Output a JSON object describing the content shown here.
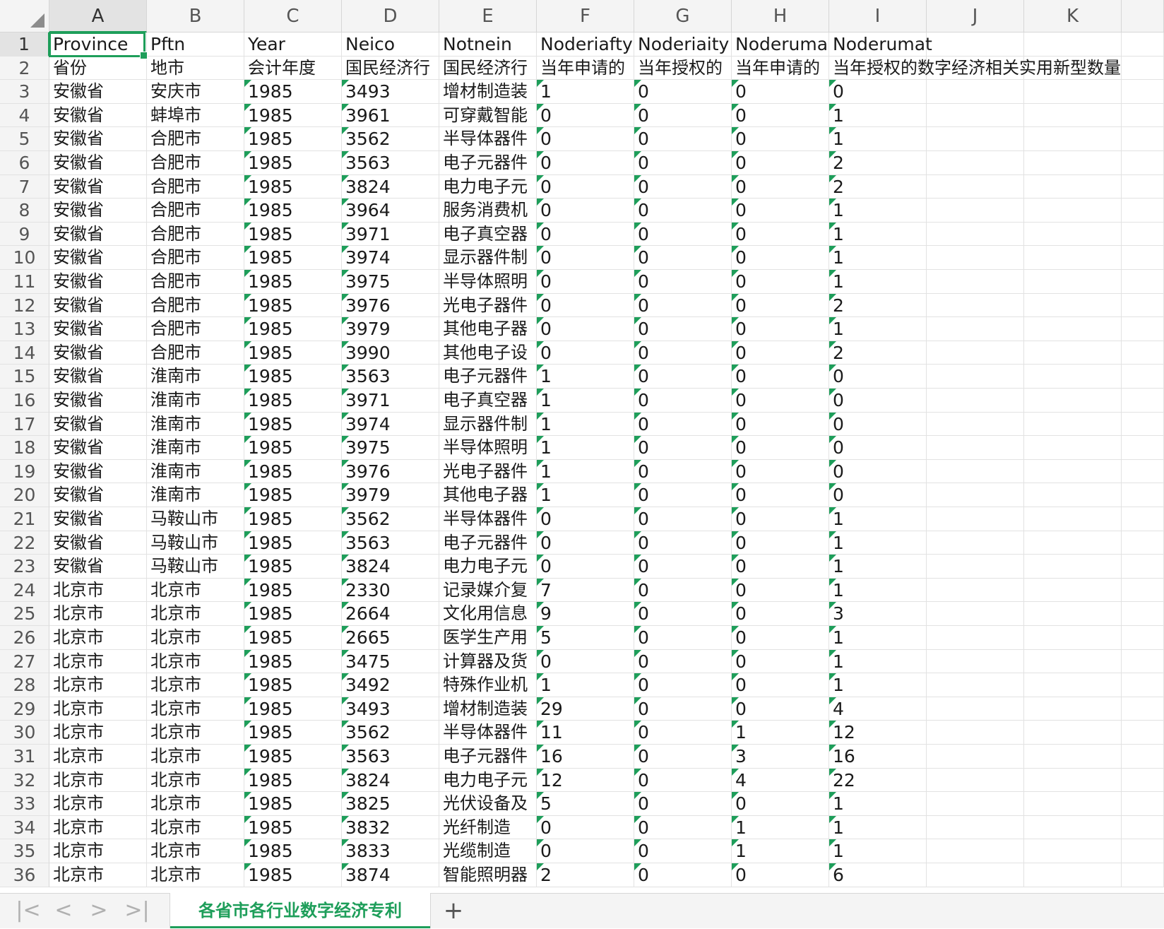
{
  "columns": [
    "A",
    "B",
    "C",
    "D",
    "E",
    "F",
    "G",
    "H",
    "I",
    "J",
    "K"
  ],
  "active_cell": "A1",
  "rows": [
    {
      "num": "1",
      "cells": [
        "Province",
        "Pftn",
        "Year",
        "Neico",
        "Notnein",
        "Noderiafty",
        "Noderiaity",
        "Noderumap",
        "Noderumat",
        "",
        ""
      ]
    },
    {
      "num": "2",
      "cells": [
        "省份",
        "地市",
        "会计年度",
        "国民经济行",
        "国民经济行",
        "当年申请的",
        "当年授权的",
        "当年申请的",
        "当年授权的数字经济相关实用新型数量",
        "",
        ""
      ]
    },
    {
      "num": "3",
      "cells": [
        "安徽省",
        "安庆市",
        "1985",
        "3493",
        "增材制造装",
        "1",
        "0",
        "0",
        "0",
        "",
        ""
      ]
    },
    {
      "num": "4",
      "cells": [
        "安徽省",
        "蚌埠市",
        "1985",
        "3961",
        "可穿戴智能",
        "0",
        "0",
        "0",
        "1",
        "",
        ""
      ]
    },
    {
      "num": "5",
      "cells": [
        "安徽省",
        "合肥市",
        "1985",
        "3562",
        "半导体器件",
        "0",
        "0",
        "0",
        "1",
        "",
        ""
      ]
    },
    {
      "num": "6",
      "cells": [
        "安徽省",
        "合肥市",
        "1985",
        "3563",
        "电子元器件",
        "0",
        "0",
        "0",
        "2",
        "",
        ""
      ]
    },
    {
      "num": "7",
      "cells": [
        "安徽省",
        "合肥市",
        "1985",
        "3824",
        "电力电子元",
        "0",
        "0",
        "0",
        "2",
        "",
        ""
      ]
    },
    {
      "num": "8",
      "cells": [
        "安徽省",
        "合肥市",
        "1985",
        "3964",
        "服务消费机",
        "0",
        "0",
        "0",
        "1",
        "",
        ""
      ]
    },
    {
      "num": "9",
      "cells": [
        "安徽省",
        "合肥市",
        "1985",
        "3971",
        "电子真空器",
        "0",
        "0",
        "0",
        "1",
        "",
        ""
      ]
    },
    {
      "num": "10",
      "cells": [
        "安徽省",
        "合肥市",
        "1985",
        "3974",
        "显示器件制",
        "0",
        "0",
        "0",
        "1",
        "",
        ""
      ]
    },
    {
      "num": "11",
      "cells": [
        "安徽省",
        "合肥市",
        "1985",
        "3975",
        "半导体照明",
        "0",
        "0",
        "0",
        "1",
        "",
        ""
      ]
    },
    {
      "num": "12",
      "cells": [
        "安徽省",
        "合肥市",
        "1985",
        "3976",
        "光电子器件",
        "0",
        "0",
        "0",
        "2",
        "",
        ""
      ]
    },
    {
      "num": "13",
      "cells": [
        "安徽省",
        "合肥市",
        "1985",
        "3979",
        "其他电子器",
        "0",
        "0",
        "0",
        "1",
        "",
        ""
      ]
    },
    {
      "num": "14",
      "cells": [
        "安徽省",
        "合肥市",
        "1985",
        "3990",
        "其他电子设",
        "0",
        "0",
        "0",
        "2",
        "",
        ""
      ]
    },
    {
      "num": "15",
      "cells": [
        "安徽省",
        "淮南市",
        "1985",
        "3563",
        "电子元器件",
        "1",
        "0",
        "0",
        "0",
        "",
        ""
      ]
    },
    {
      "num": "16",
      "cells": [
        "安徽省",
        "淮南市",
        "1985",
        "3971",
        "电子真空器",
        "1",
        "0",
        "0",
        "0",
        "",
        ""
      ]
    },
    {
      "num": "17",
      "cells": [
        "安徽省",
        "淮南市",
        "1985",
        "3974",
        "显示器件制",
        "1",
        "0",
        "0",
        "0",
        "",
        ""
      ]
    },
    {
      "num": "18",
      "cells": [
        "安徽省",
        "淮南市",
        "1985",
        "3975",
        "半导体照明",
        "1",
        "0",
        "0",
        "0",
        "",
        ""
      ]
    },
    {
      "num": "19",
      "cells": [
        "安徽省",
        "淮南市",
        "1985",
        "3976",
        "光电子器件",
        "1",
        "0",
        "0",
        "0",
        "",
        ""
      ]
    },
    {
      "num": "20",
      "cells": [
        "安徽省",
        "淮南市",
        "1985",
        "3979",
        "其他电子器",
        "1",
        "0",
        "0",
        "0",
        "",
        ""
      ]
    },
    {
      "num": "21",
      "cells": [
        "安徽省",
        "马鞍山市",
        "1985",
        "3562",
        "半导体器件",
        "0",
        "0",
        "0",
        "1",
        "",
        ""
      ]
    },
    {
      "num": "22",
      "cells": [
        "安徽省",
        "马鞍山市",
        "1985",
        "3563",
        "电子元器件",
        "0",
        "0",
        "0",
        "1",
        "",
        ""
      ]
    },
    {
      "num": "23",
      "cells": [
        "安徽省",
        "马鞍山市",
        "1985",
        "3824",
        "电力电子元",
        "0",
        "0",
        "0",
        "1",
        "",
        ""
      ]
    },
    {
      "num": "24",
      "cells": [
        "北京市",
        "北京市",
        "1985",
        "2330",
        "记录媒介复",
        "7",
        "0",
        "0",
        "1",
        "",
        ""
      ]
    },
    {
      "num": "25",
      "cells": [
        "北京市",
        "北京市",
        "1985",
        "2664",
        "文化用信息",
        "9",
        "0",
        "0",
        "3",
        "",
        ""
      ]
    },
    {
      "num": "26",
      "cells": [
        "北京市",
        "北京市",
        "1985",
        "2665",
        "医学生产用",
        "5",
        "0",
        "0",
        "1",
        "",
        ""
      ]
    },
    {
      "num": "27",
      "cells": [
        "北京市",
        "北京市",
        "1985",
        "3475",
        "计算器及货",
        "0",
        "0",
        "0",
        "1",
        "",
        ""
      ]
    },
    {
      "num": "28",
      "cells": [
        "北京市",
        "北京市",
        "1985",
        "3492",
        "特殊作业机",
        "1",
        "0",
        "0",
        "1",
        "",
        ""
      ]
    },
    {
      "num": "29",
      "cells": [
        "北京市",
        "北京市",
        "1985",
        "3493",
        "增材制造装",
        "29",
        "0",
        "0",
        "4",
        "",
        ""
      ]
    },
    {
      "num": "30",
      "cells": [
        "北京市",
        "北京市",
        "1985",
        "3562",
        "半导体器件",
        "11",
        "0",
        "1",
        "12",
        "",
        ""
      ]
    },
    {
      "num": "31",
      "cells": [
        "北京市",
        "北京市",
        "1985",
        "3563",
        "电子元器件",
        "16",
        "0",
        "3",
        "16",
        "",
        ""
      ]
    },
    {
      "num": "32",
      "cells": [
        "北京市",
        "北京市",
        "1985",
        "3824",
        "电力电子元",
        "12",
        "0",
        "4",
        "22",
        "",
        ""
      ]
    },
    {
      "num": "33",
      "cells": [
        "北京市",
        "北京市",
        "1985",
        "3825",
        "光伏设备及",
        "5",
        "0",
        "0",
        "1",
        "",
        ""
      ]
    },
    {
      "num": "34",
      "cells": [
        "北京市",
        "北京市",
        "1985",
        "3832",
        "光纤制造",
        "0",
        "0",
        "1",
        "1",
        "",
        ""
      ]
    },
    {
      "num": "35",
      "cells": [
        "北京市",
        "北京市",
        "1985",
        "3833",
        "光缆制造",
        "0",
        "0",
        "1",
        "1",
        "",
        ""
      ]
    },
    {
      "num": "36",
      "cells": [
        "北京市",
        "北京市",
        "1985",
        "3874",
        "智能照明器",
        "2",
        "0",
        "0",
        "6",
        "",
        ""
      ]
    }
  ],
  "tabbar": {
    "first_label": "|<",
    "prev_label": "<",
    "next_label": ">",
    "last_label": ">|",
    "sheet_name": "各省市各行业数字经济专利",
    "add_label": "+"
  }
}
